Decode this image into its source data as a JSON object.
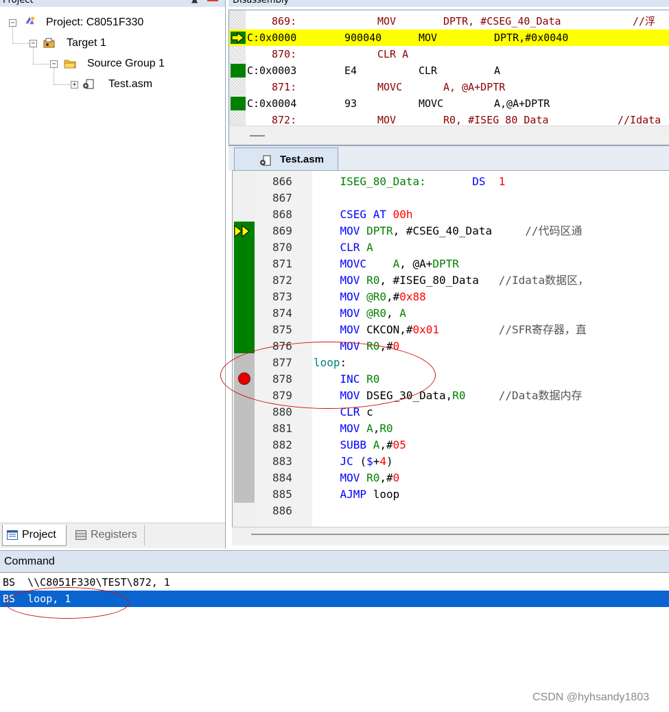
{
  "project_pane": {
    "title": "Project",
    "tree": [
      {
        "label": "Project: C8051F330",
        "icon": "project-icon"
      },
      {
        "label": "Target 1",
        "icon": "target-icon"
      },
      {
        "label": "Source Group 1",
        "icon": "folder-icon"
      },
      {
        "label": "Test.asm",
        "icon": "asm-file-icon"
      }
    ],
    "tabs": {
      "project": "Project",
      "registers": "Registers"
    }
  },
  "disassembly": {
    "title": "Disassembly",
    "lines": [
      {
        "a": "869:",
        "b": "MOV",
        "c": "DPTR, #CSEG_40_Data",
        "d": "//浮",
        "kind": "src"
      },
      {
        "a": "C:0x0000",
        "b": "900040",
        "c": "MOV",
        "d": "DPTR,#0x0040",
        "kind": "current"
      },
      {
        "a": "870:",
        "b": "CLR A",
        "c": "",
        "d": "",
        "kind": "src"
      },
      {
        "a": "C:0x0003",
        "b": "E4",
        "c": "CLR",
        "d": "A",
        "kind": "asm"
      },
      {
        "a": "871:",
        "b": "MOVC",
        "c": "A, @A+DPTR",
        "d": "",
        "kind": "src"
      },
      {
        "a": "C:0x0004",
        "b": "93",
        "c": "MOVC",
        "d": "A,@A+DPTR",
        "kind": "asm"
      },
      {
        "a": "872:",
        "b": "MOV",
        "c": "R0, #ISEG_80_Data",
        "d": "//Idata",
        "kind": "src"
      }
    ]
  },
  "editor": {
    "tab": "Test.asm",
    "lines": [
      {
        "n": "866",
        "parts": [
          [
            "    ",
            ""
          ],
          [
            "ISEG_80_Data:",
            "reg"
          ],
          [
            "       DS  ",
            "kw"
          ],
          [
            "1",
            "num"
          ]
        ]
      },
      {
        "n": "867",
        "parts": []
      },
      {
        "n": "868",
        "parts": [
          [
            "    ",
            ""
          ],
          [
            "CSEG AT ",
            "kw"
          ],
          [
            "00h",
            "num"
          ]
        ]
      },
      {
        "n": "869",
        "parts": [
          [
            "    ",
            ""
          ],
          [
            "MOV ",
            "kw"
          ],
          [
            "DPTR",
            "reg"
          ],
          [
            ", #CSEG_40_Data     ",
            ""
          ],
          [
            "//代码区通",
            "cmt"
          ]
        ]
      },
      {
        "n": "870",
        "parts": [
          [
            "    ",
            ""
          ],
          [
            "CLR ",
            "kw"
          ],
          [
            "A",
            "reg"
          ]
        ]
      },
      {
        "n": "871",
        "parts": [
          [
            "    ",
            ""
          ],
          [
            "MOVC    ",
            "kw"
          ],
          [
            "A",
            "reg"
          ],
          [
            ", @A+",
            ""
          ],
          [
            "DPTR",
            "reg"
          ]
        ]
      },
      {
        "n": "872",
        "parts": [
          [
            "    ",
            ""
          ],
          [
            "MOV ",
            "kw"
          ],
          [
            "R0",
            "reg"
          ],
          [
            ", #ISEG_80_Data   ",
            ""
          ],
          [
            "//Idata数据区，",
            "cmt"
          ]
        ]
      },
      {
        "n": "873",
        "parts": [
          [
            "    ",
            ""
          ],
          [
            "MOV ",
            "kw"
          ],
          [
            "@R0",
            "reg"
          ],
          [
            ",#",
            ""
          ],
          [
            "0x88",
            "num"
          ]
        ]
      },
      {
        "n": "874",
        "parts": [
          [
            "    ",
            ""
          ],
          [
            "MOV ",
            "kw"
          ],
          [
            "@R0",
            "reg"
          ],
          [
            ", ",
            ""
          ],
          [
            "A",
            "reg"
          ]
        ]
      },
      {
        "n": "875",
        "parts": [
          [
            "    ",
            ""
          ],
          [
            "MOV ",
            "kw"
          ],
          [
            "CKCON,#",
            ""
          ],
          [
            "0x01",
            "num"
          ],
          [
            "         //SFR寄存器，直",
            "cmt"
          ]
        ]
      },
      {
        "n": "876",
        "parts": [
          [
            "    ",
            ""
          ],
          [
            "MOV ",
            "kw"
          ],
          [
            "R0",
            "reg"
          ],
          [
            ",#",
            ""
          ],
          [
            "0",
            "num"
          ]
        ]
      },
      {
        "n": "877",
        "parts": [
          [
            "loop",
            "cm"
          ],
          [
            ":",
            ""
          ]
        ]
      },
      {
        "n": "878",
        "parts": [
          [
            "    ",
            ""
          ],
          [
            "INC ",
            "kw"
          ],
          [
            "R0",
            "reg"
          ]
        ]
      },
      {
        "n": "879",
        "parts": [
          [
            "    ",
            ""
          ],
          [
            "MOV ",
            "kw"
          ],
          [
            "DSEG_30_Data,",
            ""
          ],
          [
            "R0",
            "reg"
          ],
          [
            "     //Data数据内存",
            "cmt"
          ]
        ]
      },
      {
        "n": "880",
        "parts": [
          [
            "    ",
            ""
          ],
          [
            "CLR ",
            "kw"
          ],
          [
            "c",
            ""
          ]
        ]
      },
      {
        "n": "881",
        "parts": [
          [
            "    ",
            ""
          ],
          [
            "MOV ",
            "kw"
          ],
          [
            "A",
            "reg"
          ],
          [
            ",",
            ""
          ],
          [
            "R0",
            "reg"
          ]
        ]
      },
      {
        "n": "882",
        "parts": [
          [
            "    ",
            ""
          ],
          [
            "SUBB ",
            "kw"
          ],
          [
            "A",
            "reg"
          ],
          [
            ",#",
            ""
          ],
          [
            "05",
            "num"
          ]
        ]
      },
      {
        "n": "883",
        "parts": [
          [
            "    ",
            ""
          ],
          [
            "JC ",
            "kw"
          ],
          [
            "(",
            ""
          ],
          [
            "$",
            "kw"
          ],
          [
            "+",
            ""
          ],
          [
            "4",
            "num"
          ],
          [
            ")",
            ""
          ]
        ]
      },
      {
        "n": "884",
        "parts": [
          [
            "    ",
            ""
          ],
          [
            "MOV ",
            "kw"
          ],
          [
            "R0",
            "reg"
          ],
          [
            ",#",
            ""
          ],
          [
            "0",
            "num"
          ]
        ]
      },
      {
        "n": "885",
        "parts": [
          [
            "    ",
            ""
          ],
          [
            "AJMP ",
            "kw"
          ],
          [
            "loop",
            ""
          ]
        ]
      },
      {
        "n": "886",
        "parts": []
      }
    ]
  },
  "command": {
    "title": "Command",
    "lines": [
      "BS  \\\\C8051F330\\TEST\\872, 1",
      "BS  loop, 1"
    ]
  },
  "watermark": "CSDN @hyhsandy1803",
  "colors": {
    "keyword": "#0000ff",
    "register": "#008000",
    "number": "#ff0000",
    "selection": "#0a64d0",
    "current_line": "#ffff00"
  }
}
